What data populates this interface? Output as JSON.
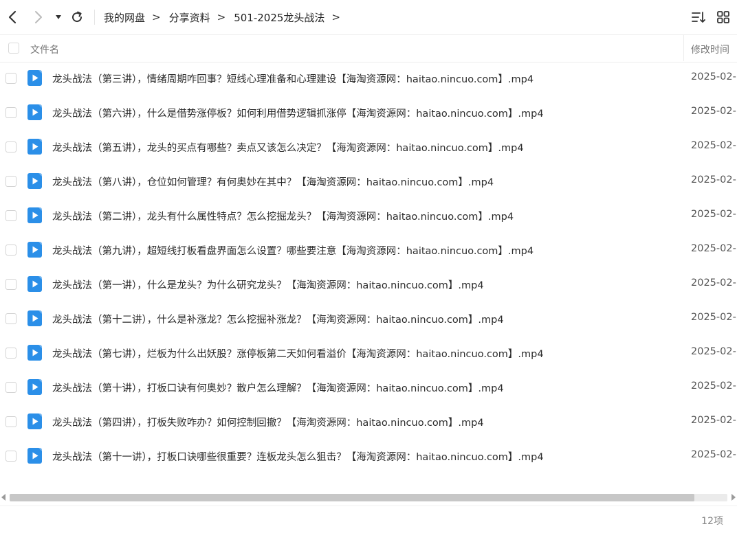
{
  "breadcrumb": [
    {
      "label": "我的网盘"
    },
    {
      "label": "分享资料"
    },
    {
      "label": "501-2025龙头战法"
    }
  ],
  "header": {
    "name_label": "文件名",
    "time_label": "修改时间"
  },
  "icon_colors": {
    "video_file": "#2b8fe8"
  },
  "files": [
    {
      "name": "龙头战法（第三讲），情绪周期咋回事？短线心理准备和心理建设【海淘资源网：haitao.nincuo.com】.mp4",
      "time": "2025-02-"
    },
    {
      "name": "龙头战法（第六讲），什么是借势涨停板？如何利用借势逻辑抓涨停【海淘资源网：haitao.nincuo.com】.mp4",
      "time": "2025-02-"
    },
    {
      "name": "龙头战法（第五讲），龙头的买点有哪些？卖点又该怎么决定？【海淘资源网：haitao.nincuo.com】.mp4",
      "time": "2025-02-"
    },
    {
      "name": "龙头战法（第八讲），仓位如何管理？有何奥妙在其中？【海淘资源网：haitao.nincuo.com】.mp4",
      "time": "2025-02-"
    },
    {
      "name": "龙头战法（第二讲），龙头有什么属性特点？怎么挖掘龙头？【海淘资源网：haitao.nincuo.com】.mp4",
      "time": "2025-02-"
    },
    {
      "name": "龙头战法（第九讲），超短线打板看盘界面怎么设置？哪些要注意【海淘资源网：haitao.nincuo.com】.mp4",
      "time": "2025-02-"
    },
    {
      "name": "龙头战法（第一讲），什么是龙头？为什么研究龙头？【海淘资源网：haitao.nincuo.com】.mp4",
      "time": "2025-02-"
    },
    {
      "name": "龙头战法（第十二讲），什么是补涨龙？怎么挖掘补涨龙？【海淘资源网：haitao.nincuo.com】.mp4",
      "time": "2025-02-"
    },
    {
      "name": "龙头战法（第七讲），烂板为什么出妖股？涨停板第二天如何看溢价【海淘资源网：haitao.nincuo.com】.mp4",
      "time": "2025-02-"
    },
    {
      "name": "龙头战法（第十讲），打板口诀有何奥妙？散户怎么理解？【海淘资源网：haitao.nincuo.com】.mp4",
      "time": "2025-02-"
    },
    {
      "name": "龙头战法（第四讲），打板失败咋办？如何控制回撤？【海淘资源网：haitao.nincuo.com】.mp4",
      "time": "2025-02-"
    },
    {
      "name": "龙头战法（第十一讲），打板口诀哪些很重要？连板龙头怎么狙击？【海淘资源网：haitao.nincuo.com】.mp4",
      "time": "2025-02-"
    }
  ],
  "footer": {
    "count": "12项"
  }
}
